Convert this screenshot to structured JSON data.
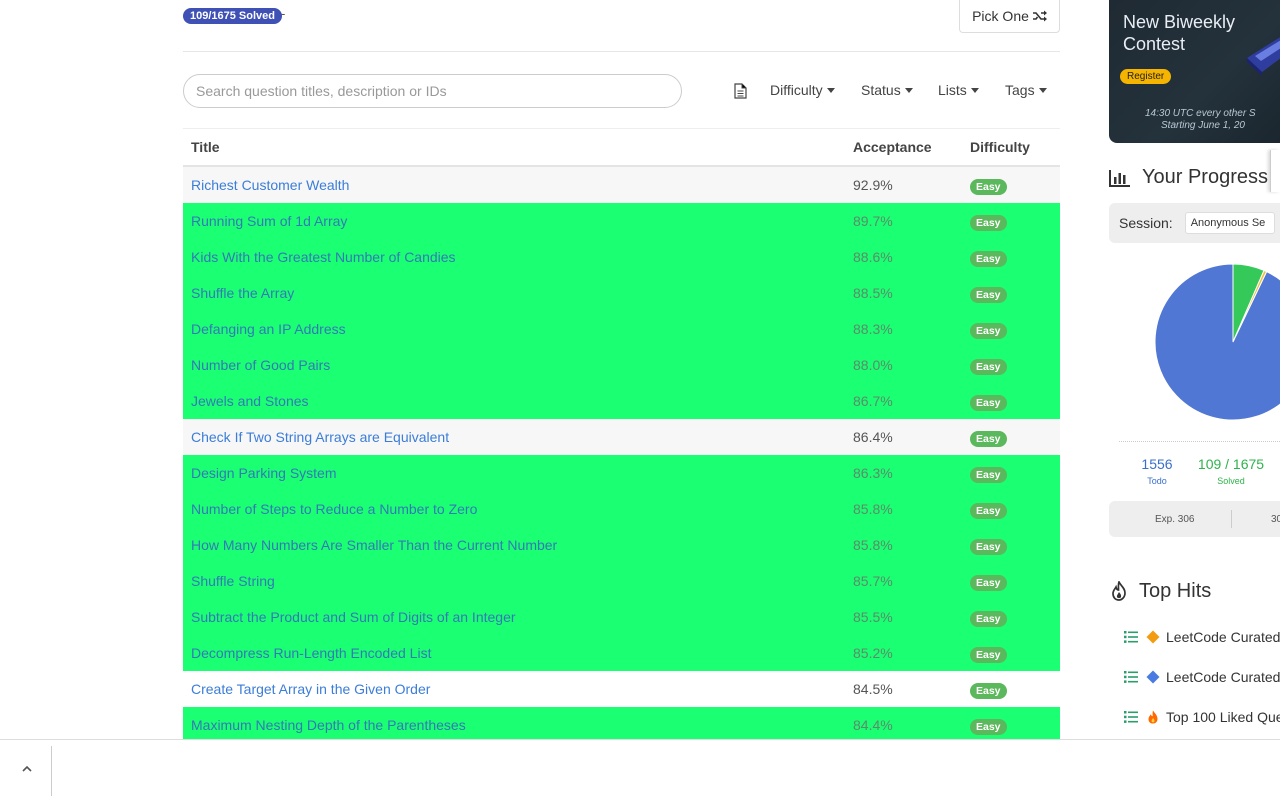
{
  "header": {
    "solved_badge": "109/1675 Solved",
    "solved_suffix": "-",
    "pick_one_label": "Pick One"
  },
  "filters": {
    "search_placeholder": "Search question titles, description or IDs",
    "difficulty": "Difficulty",
    "status": "Status",
    "lists": "Lists",
    "tags": "Tags"
  },
  "table": {
    "headers": {
      "title": "Title",
      "acceptance": "Acceptance",
      "difficulty": "Difficulty"
    },
    "rows": [
      {
        "title": "Richest Customer Wealth",
        "acceptance": "92.9%",
        "difficulty": "Easy",
        "solved": false
      },
      {
        "title": "Running Sum of 1d Array",
        "acceptance": "89.7%",
        "difficulty": "Easy",
        "solved": true
      },
      {
        "title": "Kids With the Greatest Number of Candies",
        "acceptance": "88.6%",
        "difficulty": "Easy",
        "solved": true
      },
      {
        "title": "Shuffle the Array",
        "acceptance": "88.5%",
        "difficulty": "Easy",
        "solved": true
      },
      {
        "title": "Defanging an IP Address",
        "acceptance": "88.3%",
        "difficulty": "Easy",
        "solved": true
      },
      {
        "title": "Number of Good Pairs",
        "acceptance": "88.0%",
        "difficulty": "Easy",
        "solved": true
      },
      {
        "title": "Jewels and Stones",
        "acceptance": "86.7%",
        "difficulty": "Easy",
        "solved": true
      },
      {
        "title": "Check If Two String Arrays are Equivalent",
        "acceptance": "86.4%",
        "difficulty": "Easy",
        "solved": false
      },
      {
        "title": "Design Parking System",
        "acceptance": "86.3%",
        "difficulty": "Easy",
        "solved": true
      },
      {
        "title": "Number of Steps to Reduce a Number to Zero",
        "acceptance": "85.8%",
        "difficulty": "Easy",
        "solved": true
      },
      {
        "title": "How Many Numbers Are Smaller Than the Current Number",
        "acceptance": "85.8%",
        "difficulty": "Easy",
        "solved": true
      },
      {
        "title": "Shuffle String",
        "acceptance": "85.7%",
        "difficulty": "Easy",
        "solved": true
      },
      {
        "title": "Subtract the Product and Sum of Digits of an Integer",
        "acceptance": "85.5%",
        "difficulty": "Easy",
        "solved": true
      },
      {
        "title": "Decompress Run-Length Encoded List",
        "acceptance": "85.2%",
        "difficulty": "Easy",
        "solved": true
      },
      {
        "title": "Create Target Array in the Given Order",
        "acceptance": "84.5%",
        "difficulty": "Easy",
        "solved": false
      },
      {
        "title": "Maximum Nesting Depth of the Parentheses",
        "acceptance": "84.4%",
        "difficulty": "Easy",
        "solved": true
      }
    ]
  },
  "sidebar": {
    "contest": {
      "title_line1": "New Biweekly",
      "title_line2": "Contest",
      "register": "Register",
      "time_line1": "14:30 UTC every other S",
      "time_line2": "Starting June 1, 20"
    },
    "progress": {
      "title": "Your Progress",
      "session_label": "Session:",
      "session_value": "Anonymous Se",
      "todo_value": "1556",
      "todo_label": "Todo",
      "solved_value": "109 / 1675",
      "solved_label": "Solved",
      "exp_label": "Exp. 306",
      "exp_more": "30",
      "pie": {
        "todo": 1556,
        "solved": 109,
        "other": 10
      },
      "colors": {
        "todo": "#5177d4",
        "solved": "#35c959",
        "other": "#f0c040"
      }
    },
    "top_hits": {
      "title": "Top Hits",
      "items": [
        {
          "label": "LeetCode Curated",
          "icon": "orange-diamond-icon"
        },
        {
          "label": "LeetCode Curated",
          "icon": "blue-diamond-icon"
        },
        {
          "label": "Top 100 Liked Que",
          "icon": "fire-icon"
        }
      ]
    }
  }
}
